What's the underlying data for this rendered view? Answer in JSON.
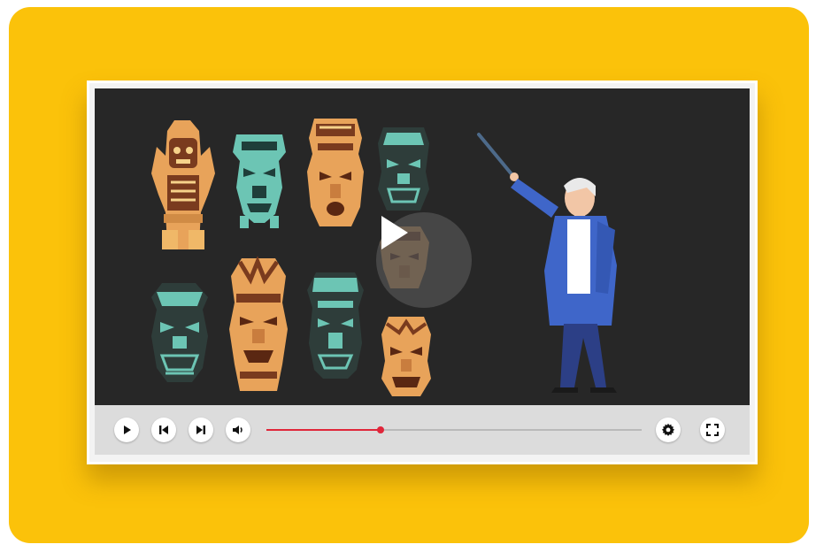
{
  "player": {
    "progress_fraction": 0.305,
    "colors": {
      "page_background": "#fbc20a",
      "screen_background": "#272727",
      "controls_background": "#dcdcdc",
      "progress_played": "#e0263a",
      "progress_remaining": "#b9b9b9",
      "mask_orange": "#e8a35a",
      "mask_teal": "#6cc5b4",
      "presenter_jacket": "#3f66c9"
    },
    "icons": {
      "center": "play-icon",
      "play": "play-icon",
      "previous": "skip-previous-icon",
      "next": "skip-next-icon",
      "volume": "volume-icon",
      "settings": "gear-icon",
      "fullscreen": "fullscreen-icon"
    }
  },
  "scene": {
    "masks": [
      {
        "name": "mask-1",
        "palette": "orange"
      },
      {
        "name": "mask-2",
        "palette": "teal"
      },
      {
        "name": "mask-3",
        "palette": "orange"
      },
      {
        "name": "mask-4",
        "palette": "teal"
      },
      {
        "name": "mask-5",
        "palette": "teal"
      },
      {
        "name": "mask-6",
        "palette": "orange"
      },
      {
        "name": "mask-7",
        "palette": "teal"
      },
      {
        "name": "mask-8",
        "palette": "orange"
      },
      {
        "name": "mask-9",
        "palette": "orange"
      }
    ],
    "presenter": "presenter-with-pointer"
  }
}
